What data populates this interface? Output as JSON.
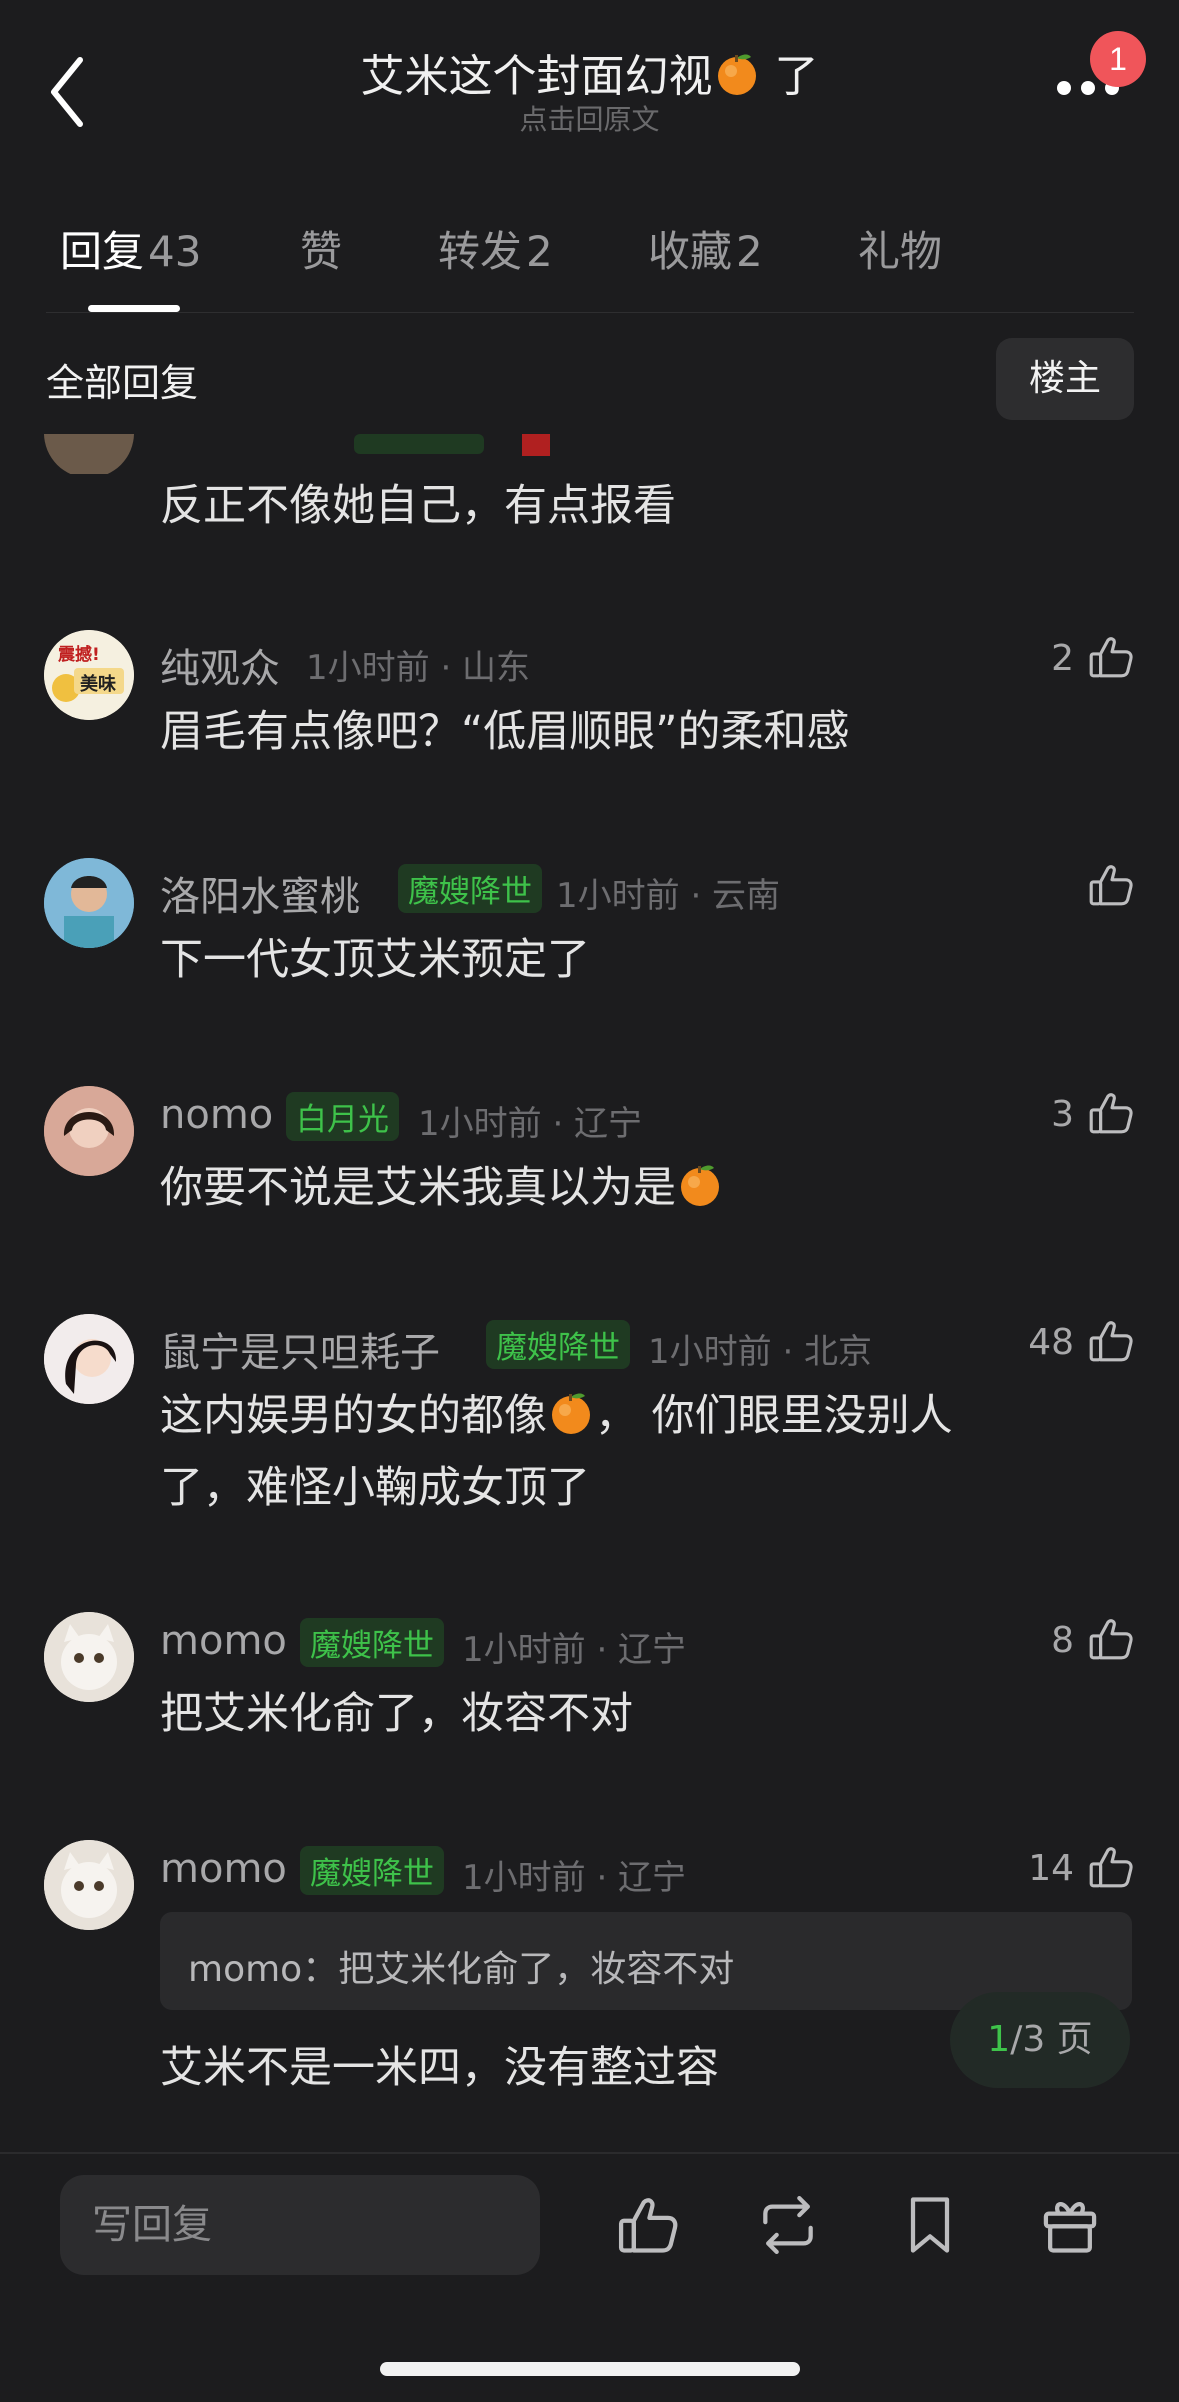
{
  "header": {
    "title": "艾米这个封面幻视",
    "title_suffix": "了",
    "subtitle": "点击回原文",
    "notification_count": "1"
  },
  "tabs": [
    {
      "label": "回复",
      "count": "43"
    },
    {
      "label": "赞",
      "count": ""
    },
    {
      "label": "转发",
      "count": "2"
    },
    {
      "label": "收藏",
      "count": "2"
    },
    {
      "label": "礼物",
      "count": ""
    }
  ],
  "section": {
    "title": "全部回复",
    "owner_button": "楼主"
  },
  "comments": [
    {
      "text": "反正不像她自己，有点报看"
    },
    {
      "user": "纯观众",
      "meta": "1小时前 · 山东",
      "likes": "2",
      "text": "眉毛有点像吧？“低眉顺眼”的柔和感",
      "avatar_text1": "震撼!",
      "avatar_text2": "美味"
    },
    {
      "user": "洛阳水蜜桃",
      "tag": "魔嫂降世",
      "meta": "1小时前 · 云南",
      "likes": "",
      "text": "下一代女顶艾米预定了"
    },
    {
      "user": "nomo",
      "tag": "白月光",
      "meta": "1小时前 · 辽宁",
      "likes": "3",
      "text": "你要不说是艾米我真以为是"
    },
    {
      "user": "鼠宁是只呾耗子",
      "tag": "魔嫂降世",
      "meta": "1小时前 · 北京",
      "likes": "48",
      "text1a": "这内娱男的女的都像",
      "text1b": "，  你们眼里没别人",
      "text2": "了，难怪小鞠成女顶了"
    },
    {
      "user": "momo",
      "tag": "魔嫂降世",
      "meta": "1小时前 · 辽宁",
      "likes": "8",
      "text": "把艾米化俞了，妆容不对"
    },
    {
      "user": "momo",
      "tag": "魔嫂降世",
      "meta": "1小时前 · 辽宁",
      "likes": "14",
      "quote": "momo：把艾米化俞了，妆容不对",
      "text": "艾米不是一米四，没有整过容"
    }
  ],
  "pager": {
    "current": "1",
    "rest": "/3 页"
  },
  "bottom_bar": {
    "reply_placeholder": "写回复"
  },
  "colors": {
    "background": "#1c1c1e",
    "accent_green": "#3ec24a",
    "badge_red": "#f0555a"
  },
  "icons": [
    "back-arrow-icon",
    "more-dots-icon",
    "thumbs-up-icon",
    "orange-emoji-icon",
    "repost-icon",
    "bookmark-icon",
    "gift-icon"
  ]
}
